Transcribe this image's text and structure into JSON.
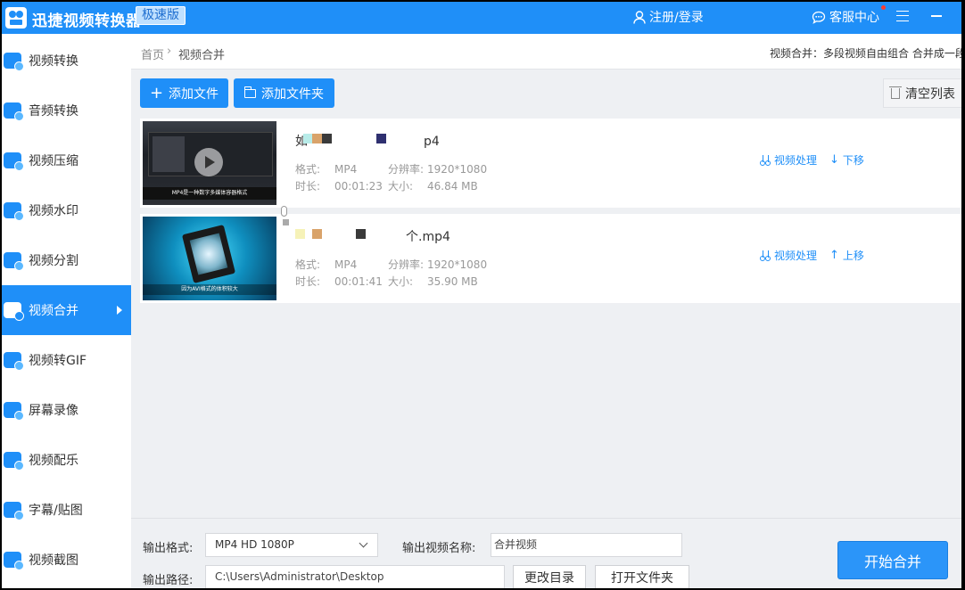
{
  "app": {
    "title": "迅捷视频转换器",
    "edition": "极速版",
    "login": "注册/登录",
    "service": "客服中心"
  },
  "sidebar": {
    "items": [
      {
        "label": "视频转换",
        "icon": "video-convert-icon"
      },
      {
        "label": "音频转换",
        "icon": "audio-convert-icon"
      },
      {
        "label": "视频压缩",
        "icon": "video-compress-icon"
      },
      {
        "label": "视频水印",
        "icon": "video-watermark-icon"
      },
      {
        "label": "视频分割",
        "icon": "video-split-icon"
      },
      {
        "label": "视频合并",
        "icon": "video-merge-icon",
        "active": true
      },
      {
        "label": "视频转GIF",
        "icon": "video-gif-icon"
      },
      {
        "label": "屏幕录像",
        "icon": "screen-record-icon"
      },
      {
        "label": "视频配乐",
        "icon": "video-music-icon"
      },
      {
        "label": "字幕/贴图",
        "icon": "subtitle-sticker-icon"
      },
      {
        "label": "视频截图",
        "icon": "video-screenshot-icon"
      }
    ]
  },
  "breadcrumb": {
    "home": "首页",
    "sep": "›",
    "current": "视频合并",
    "description": "视频合并：多段视频自由组合 合并成一段"
  },
  "toolbar": {
    "add_file": "添加文件",
    "add_folder": "添加文件夹",
    "clear_list": "清空列表"
  },
  "files": [
    {
      "name_visible_start": "如",
      "name_visible_end": "p4",
      "format_label": "格式:",
      "format": "MP4",
      "resolution_label": "分辨率:",
      "resolution": "1920*1080",
      "duration_label": "时长:",
      "duration": "00:01:23",
      "size_label": "大小:",
      "size": "46.84 MB",
      "thumb_caption": "MP4是一种数字多媒体容器格式",
      "action_process": "视频处理",
      "action_move": "下移",
      "move_arrow": "↓"
    },
    {
      "name_visible_start": "",
      "name_visible_end": "个.mp4",
      "format_label": "格式:",
      "format": "MP4",
      "resolution_label": "分辨率:",
      "resolution": "1920*1080",
      "duration_label": "时长:",
      "duration": "00:01:41",
      "size_label": "大小:",
      "size": "35.90 MB",
      "thumb_caption": "因为AVI格式的体积较大",
      "action_process": "视频处理",
      "action_move": "上移",
      "move_arrow": "↑"
    }
  ],
  "output": {
    "format_label": "输出格式:",
    "format_value": "MP4   HD 1080P",
    "name_label": "输出视频名称:",
    "name_value": "合并视频",
    "path_label": "输出路径:",
    "path_value": "C:\\Users\\Administrator\\Desktop",
    "change_dir": "更改目录",
    "open_folder": "打开文件夹",
    "start": "开始合并"
  },
  "colors": {
    "accent": "#1f8ff8",
    "sidebar_active": "#1f8ff8",
    "background": "#eef0f3"
  }
}
